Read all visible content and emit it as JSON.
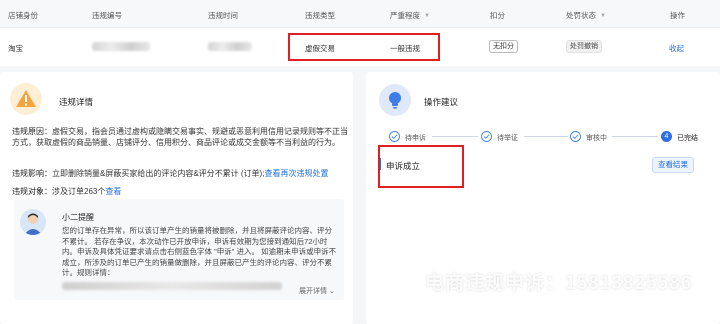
{
  "table": {
    "headers": {
      "shop": "店铺身份",
      "id": "违规编号",
      "time": "违规时间",
      "type": "违规类型",
      "severity": "严重程度",
      "deduct": "扣分",
      "status": "处罚状态",
      "action": "操作"
    },
    "row": {
      "shop": "淘宝",
      "type": "虚假交易",
      "severity": "一般违规",
      "deduct": "无扣分",
      "status": "处罚撤销",
      "action": "收起"
    }
  },
  "detail": {
    "title": "违规详情",
    "reason_label": "违规原因：",
    "reason_text": "虚假交易，指会员通过虚构或隐瞒交易事实、规避或恶意利用信用记录规则等不正当方式，获取虚假的商品销量、店铺评分、信用积分、商品评论或成交金额等不当利益的行为。",
    "impact_label": "违规影响：",
    "impact_text": "立即删除销量&屏蔽买家给出的评论内容&评分不累计 (订单);",
    "impact_link": "查看再次违规处置",
    "target_label": "违规对象：",
    "target_text": "涉及订单263个",
    "target_link": "查看"
  },
  "message": {
    "name": "小二提醒",
    "text": "您的订单存在异常，所以该订单产生的销量将被删除，并且将屏蔽评论内容、评分不累计。 若存在争议，本次动作已开放申诉，申诉有效期为您接到通知后72小时内。申诉及具体凭证要求请点击右侧蓝色字体 \"申诉\" 进入。 如逾期未申诉或申诉不成立，所涉及的订单已产生的销量做删除，并且屏蔽已产生的评论内容、评分不累计。规则详情：",
    "expand": "展开详情"
  },
  "suggest": {
    "title": "操作建议",
    "steps": [
      "待申诉",
      "待举证",
      "审核中",
      "已完结"
    ],
    "current_step_number": "4",
    "result": "申诉成立",
    "view_button": "查看结果"
  },
  "watermark": "电商违规申诉：15813825586",
  "colors": {
    "accent_blue": "#1f6fe0",
    "highlight_red": "#e02020",
    "warning_orange": "#f3a640"
  }
}
